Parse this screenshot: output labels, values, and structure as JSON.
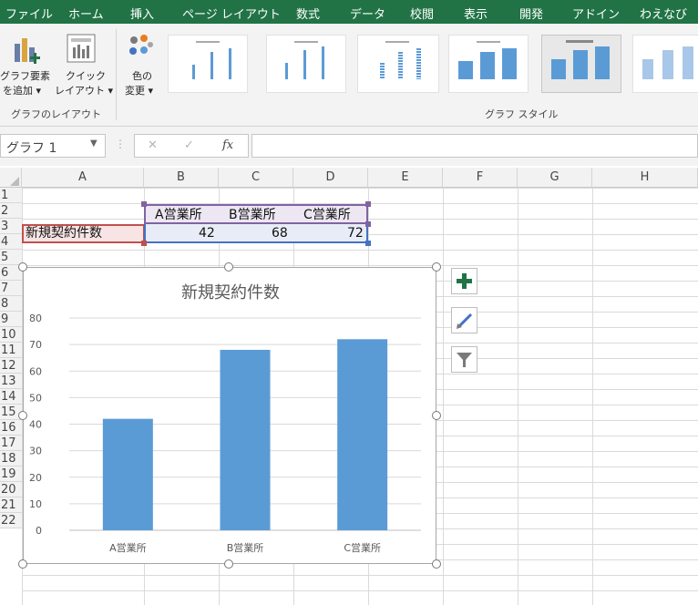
{
  "ribbon_tabs": [
    "ファイル",
    "ホーム",
    "挿入",
    "ページ レイアウト",
    "数式",
    "データ",
    "校閲",
    "表示",
    "開発",
    "アドイン",
    "わえなび"
  ],
  "ribbon": {
    "add_element": {
      "line1": "グラフ要素",
      "line2": "を追加 ▾"
    },
    "quick_layout": {
      "line1": "クイック",
      "line2": "レイアウト ▾"
    },
    "change_color": {
      "line1": "色の",
      "line2": "変更 ▾"
    },
    "group_layout": "グラフのレイアウト",
    "group_styles": "グラフ スタイル"
  },
  "formula_bar": {
    "name_box": "グラフ 1",
    "fx_label": "fx",
    "cancel": "✕",
    "enter": "✓",
    "value": ""
  },
  "columns": [
    "A",
    "B",
    "C",
    "D",
    "E",
    "F",
    "G",
    "H"
  ],
  "rows": [
    "1",
    "2",
    "3",
    "4",
    "5",
    "6",
    "7",
    "8",
    "9",
    "10",
    "11",
    "12",
    "13",
    "14",
    "15",
    "16",
    "17",
    "18",
    "19",
    "20",
    "21",
    "22"
  ],
  "cells": {
    "B2": "A営業所",
    "C2": "B営業所",
    "D2": "C営業所",
    "A3": "新規契約件数",
    "B3": "42",
    "C3": "68",
    "D3": "72"
  },
  "colors": {
    "accent": "#217346",
    "bar": "#5b9bd5",
    "range_purple": "#8064a2",
    "range_red": "#c0504d",
    "range_blue": "#4472c4"
  },
  "chart_data": {
    "type": "bar",
    "title": "新規契約件数",
    "categories": [
      "A営業所",
      "B営業所",
      "C営業所"
    ],
    "values": [
      42,
      68,
      72
    ],
    "ylim": [
      0,
      80
    ],
    "yticks": [
      "0",
      "10",
      "20",
      "30",
      "40",
      "50",
      "60",
      "70",
      "80"
    ],
    "grid": true,
    "legend": "none"
  }
}
